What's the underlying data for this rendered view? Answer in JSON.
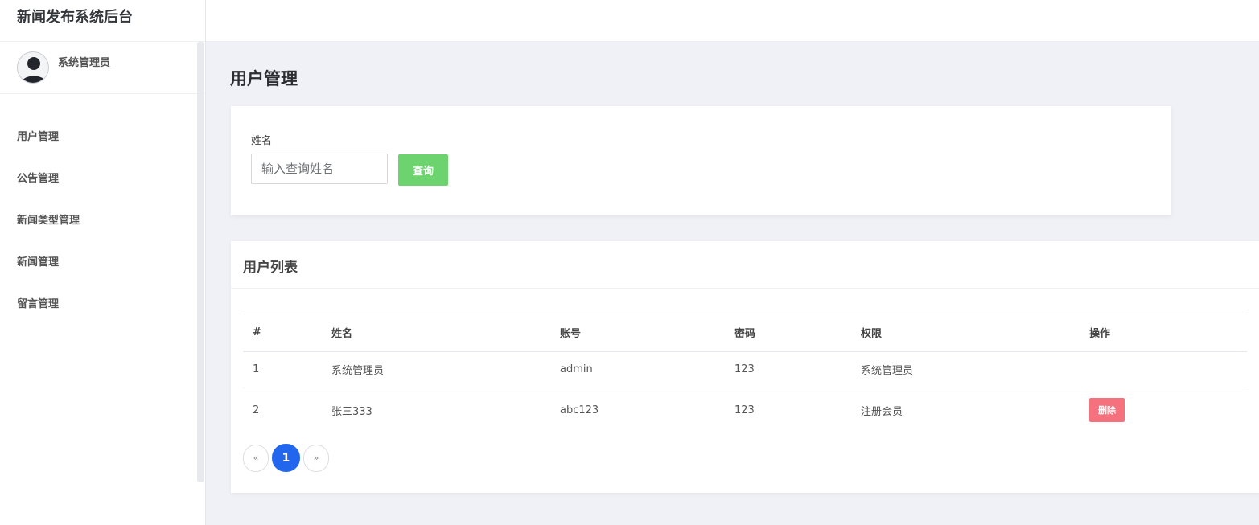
{
  "app": {
    "title": "新闻发布系统后台"
  },
  "user": {
    "name": "系统管理员"
  },
  "sidebar": {
    "items": [
      {
        "label": "用户管理"
      },
      {
        "label": "公告管理"
      },
      {
        "label": "新闻类型管理"
      },
      {
        "label": "新闻管理"
      },
      {
        "label": "留言管理"
      }
    ]
  },
  "page": {
    "title": "用户管理"
  },
  "search": {
    "label": "姓名",
    "placeholder": "输入查询姓名",
    "value": "",
    "button": "查询"
  },
  "list": {
    "title": "用户列表",
    "columns": [
      "#",
      "姓名",
      "账号",
      "密码",
      "权限",
      "操作"
    ],
    "rows": [
      {
        "idx": "1",
        "name": "系统管理员",
        "account": "admin",
        "password": "123",
        "role": "系统管理员",
        "action": ""
      },
      {
        "idx": "2",
        "name": "张三333",
        "account": "abc123",
        "password": "123",
        "role": "注册会员",
        "action": "删除"
      }
    ]
  },
  "pagination": {
    "prev": "«",
    "current": "1",
    "next": "»"
  },
  "colors": {
    "primary": "#2266ee",
    "success": "#6dd36f",
    "danger": "#f5717d",
    "background": "#f0f1f6"
  }
}
